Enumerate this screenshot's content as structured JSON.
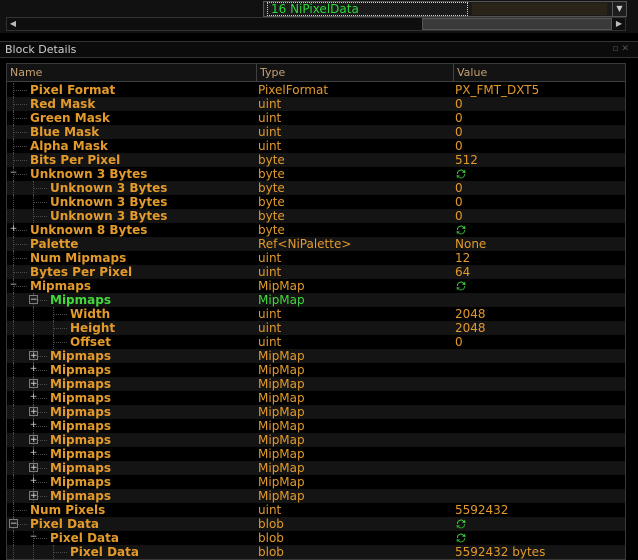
{
  "combo": {
    "value": "16 NiPixelData"
  },
  "panel": {
    "title": "Block Details"
  },
  "columns": {
    "name": "Name",
    "type": "Type",
    "value": "Value"
  },
  "colors": {
    "orange": "#e39a2b",
    "green": "#43d83b"
  },
  "rows": [
    {
      "depth": 0,
      "exp": "",
      "name": "Pixel Format",
      "type": "PixelFormat",
      "value": "PX_FMT_DXT5"
    },
    {
      "depth": 0,
      "exp": "",
      "name": "Red Mask",
      "type": "uint",
      "value": "0"
    },
    {
      "depth": 0,
      "exp": "",
      "name": "Green Mask",
      "type": "uint",
      "value": "0"
    },
    {
      "depth": 0,
      "exp": "",
      "name": "Blue Mask",
      "type": "uint",
      "value": "0"
    },
    {
      "depth": 0,
      "exp": "",
      "name": "Alpha Mask",
      "type": "uint",
      "value": "0"
    },
    {
      "depth": 0,
      "exp": "",
      "name": "Bits Per Pixel",
      "type": "byte",
      "value": "512"
    },
    {
      "depth": 0,
      "exp": "minus",
      "name": "Unknown 3 Bytes",
      "type": "byte",
      "value": "",
      "icon": "refresh-icon"
    },
    {
      "depth": 1,
      "exp": "",
      "name": "Unknown 3 Bytes",
      "type": "byte",
      "value": "0"
    },
    {
      "depth": 1,
      "exp": "",
      "name": "Unknown 3 Bytes",
      "type": "byte",
      "value": "0"
    },
    {
      "depth": 1,
      "exp": "",
      "name": "Unknown 3 Bytes",
      "type": "byte",
      "value": "0"
    },
    {
      "depth": 0,
      "exp": "plus",
      "name": "Unknown 8 Bytes",
      "type": "byte",
      "value": "",
      "icon": "refresh-icon"
    },
    {
      "depth": 0,
      "exp": "",
      "name": "Palette",
      "type": "Ref<NiPalette>",
      "value": "None"
    },
    {
      "depth": 0,
      "exp": "",
      "name": "Num Mipmaps",
      "type": "uint",
      "value": "12"
    },
    {
      "depth": 0,
      "exp": "",
      "name": "Bytes Per Pixel",
      "type": "uint",
      "value": "64"
    },
    {
      "depth": 0,
      "exp": "minus",
      "name": "Mipmaps",
      "type": "MipMap",
      "value": "",
      "icon": "refresh-icon"
    },
    {
      "depth": 1,
      "exp": "minus-box",
      "name": "Mipmaps",
      "type": "MipMap",
      "value": "",
      "green": true
    },
    {
      "depth": 2,
      "exp": "",
      "name": "Width",
      "type": "uint",
      "value": "2048"
    },
    {
      "depth": 2,
      "exp": "",
      "name": "Height",
      "type": "uint",
      "value": "2048"
    },
    {
      "depth": 2,
      "exp": "",
      "name": "Offset",
      "type": "uint",
      "value": "0"
    },
    {
      "depth": 1,
      "exp": "plus-box",
      "name": "Mipmaps",
      "type": "MipMap",
      "value": ""
    },
    {
      "depth": 1,
      "exp": "plus",
      "name": "Mipmaps",
      "type": "MipMap",
      "value": ""
    },
    {
      "depth": 1,
      "exp": "plus-box",
      "name": "Mipmaps",
      "type": "MipMap",
      "value": ""
    },
    {
      "depth": 1,
      "exp": "plus",
      "name": "Mipmaps",
      "type": "MipMap",
      "value": ""
    },
    {
      "depth": 1,
      "exp": "plus-box",
      "name": "Mipmaps",
      "type": "MipMap",
      "value": ""
    },
    {
      "depth": 1,
      "exp": "plus",
      "name": "Mipmaps",
      "type": "MipMap",
      "value": ""
    },
    {
      "depth": 1,
      "exp": "plus-box",
      "name": "Mipmaps",
      "type": "MipMap",
      "value": ""
    },
    {
      "depth": 1,
      "exp": "plus",
      "name": "Mipmaps",
      "type": "MipMap",
      "value": ""
    },
    {
      "depth": 1,
      "exp": "plus-box",
      "name": "Mipmaps",
      "type": "MipMap",
      "value": ""
    },
    {
      "depth": 1,
      "exp": "plus",
      "name": "Mipmaps",
      "type": "MipMap",
      "value": ""
    },
    {
      "depth": 1,
      "exp": "plus-box",
      "name": "Mipmaps",
      "type": "MipMap",
      "value": ""
    },
    {
      "depth": 0,
      "exp": "",
      "name": "Num Pixels",
      "type": "uint",
      "value": "5592432"
    },
    {
      "depth": 0,
      "exp": "minus-box",
      "name": "Pixel Data",
      "type": "blob",
      "value": "",
      "icon": "refresh-icon"
    },
    {
      "depth": 1,
      "exp": "minus",
      "name": "Pixel Data",
      "type": "blob",
      "value": "",
      "icon": "refresh-icon"
    },
    {
      "depth": 2,
      "exp": "",
      "name": "Pixel Data",
      "type": "blob",
      "value": "5592432 bytes"
    }
  ]
}
